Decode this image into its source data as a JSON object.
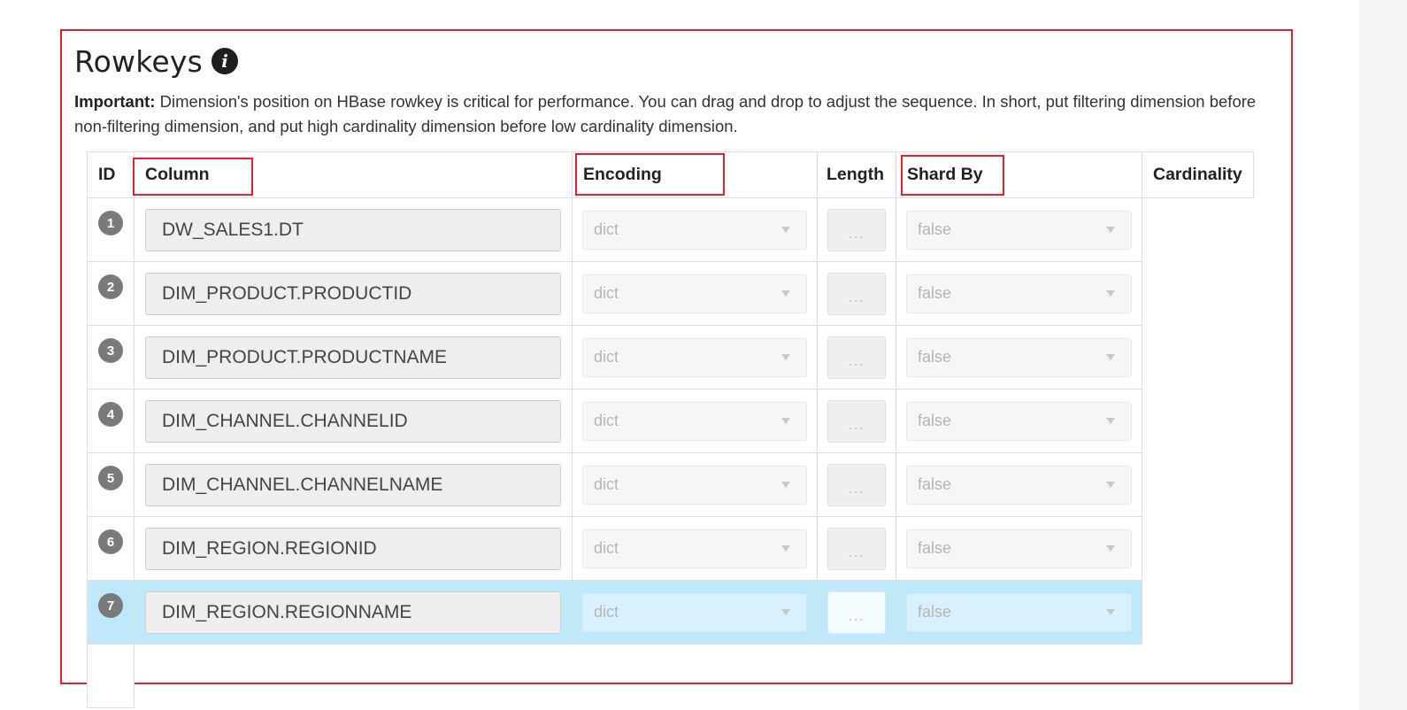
{
  "section": {
    "title": "Rowkeys",
    "info_icon": "info-circle-icon",
    "note_strong": "Important:",
    "note_text": " Dimension's position on HBase rowkey is critical for performance. You can drag and drop to adjust the sequence. In short, put filtering dimension before non-filtering dimension, and put high cardinality dimension before low cardinality dimension."
  },
  "table": {
    "headers": {
      "id": "ID",
      "column": "Column",
      "encoding": "Encoding",
      "length": "Length",
      "shard_by": "Shard By",
      "cardinality": "Cardinality"
    },
    "rows": [
      {
        "id": "1",
        "column": "DW_SALES1.DT",
        "encoding": "dict",
        "length": "...",
        "shard_by": "false"
      },
      {
        "id": "2",
        "column": "DIM_PRODUCT.PRODUCTID",
        "encoding": "dict",
        "length": "...",
        "shard_by": "false"
      },
      {
        "id": "3",
        "column": "DIM_PRODUCT.PRODUCTNAME",
        "encoding": "dict",
        "length": "...",
        "shard_by": "false"
      },
      {
        "id": "4",
        "column": "DIM_CHANNEL.CHANNELID",
        "encoding": "dict",
        "length": "...",
        "shard_by": "false"
      },
      {
        "id": "5",
        "column": "DIM_CHANNEL.CHANNELNAME",
        "encoding": "dict",
        "length": "...",
        "shard_by": "false"
      },
      {
        "id": "6",
        "column": "DIM_REGION.REGIONID",
        "encoding": "dict",
        "length": "...",
        "shard_by": "false"
      },
      {
        "id": "7",
        "column": "DIM_REGION.REGIONNAME",
        "encoding": "dict",
        "length": "...",
        "shard_by": "false"
      }
    ],
    "selected_row": "7"
  },
  "colors": {
    "highlight_border": "#e8202a",
    "selected_row_bg": "#bfe8fb",
    "badge_bg": "#7a7a7a"
  }
}
